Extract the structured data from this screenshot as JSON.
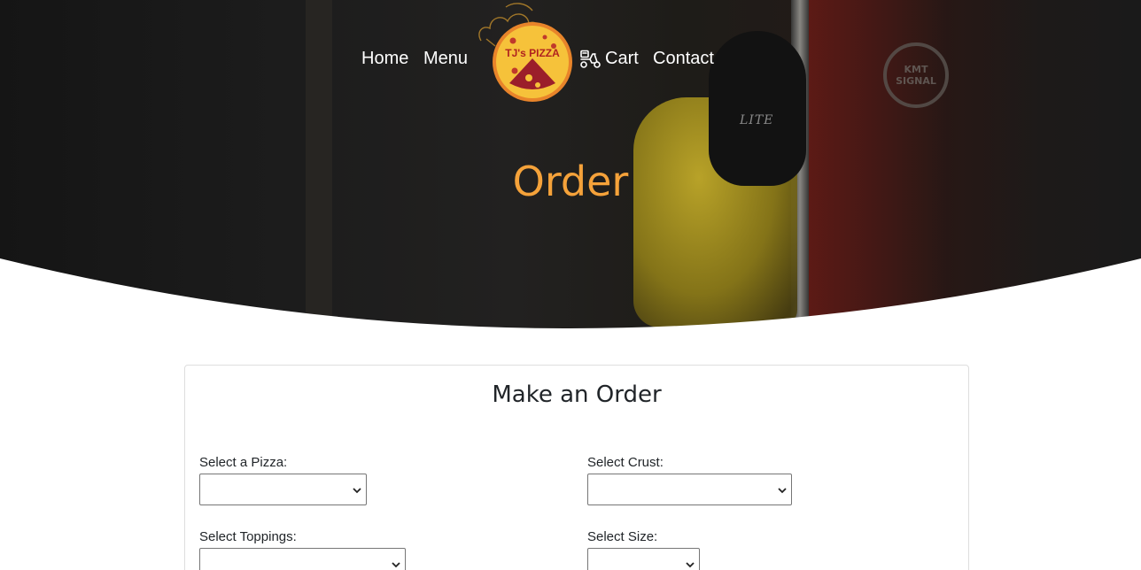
{
  "nav": {
    "home_label": "Home",
    "menu_label": "Menu",
    "cart_label": "Cart",
    "contact_label": "Contact",
    "cart_icon": "scooter-icon"
  },
  "logo": {
    "text": "TJ's PIZZA",
    "icon": "chef-hat-icon"
  },
  "hero": {
    "title": "Order",
    "title_color": "#f5a23a",
    "cap_text": "LITE",
    "sticker_text": "KMT SIGNAL"
  },
  "form": {
    "title": "Make an Order",
    "pizza_label": "Select a Pizza:",
    "pizza_value": "",
    "crust_label": "Select Crust:",
    "crust_value": "",
    "toppings_label": "Select Toppings:",
    "toppings_value": "",
    "size_label": "Select Size:",
    "size_value": ""
  }
}
